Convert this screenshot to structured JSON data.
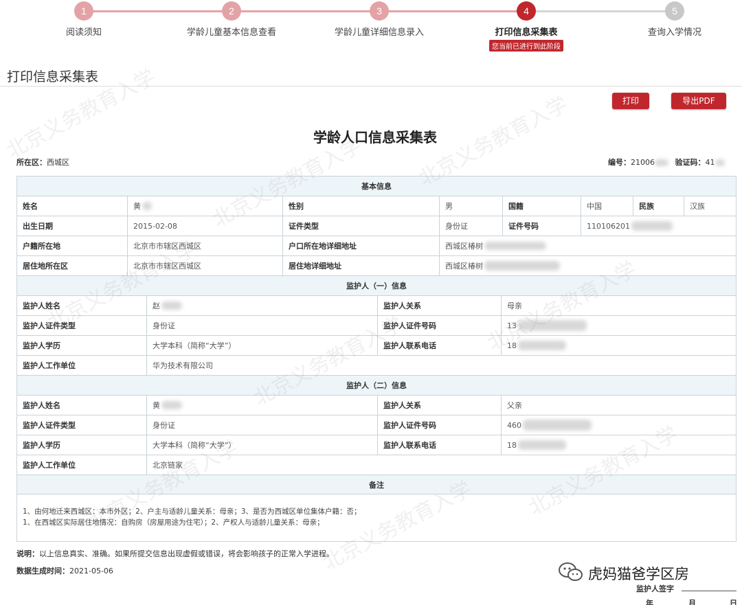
{
  "steps": [
    {
      "num": "1",
      "label": "阅读须知"
    },
    {
      "num": "2",
      "label": "学龄儿童基本信息查看"
    },
    {
      "num": "3",
      "label": "学龄儿童详细信息录入"
    },
    {
      "num": "4",
      "label": "打印信息采集表",
      "badge": "您当前已进行到此阶段"
    },
    {
      "num": "5",
      "label": "查询入学情况"
    }
  ],
  "colors": {
    "accent": "#c0272d",
    "done": "#e3a3a6",
    "pending": "#c8c8c8",
    "section_bg": "#eef5f8"
  },
  "page_title": "打印信息采集表",
  "toolbar": {
    "print_label": "打印",
    "export_label": "导出PDF"
  },
  "form": {
    "title": "学龄人口信息采集表",
    "district_label": "所在区：",
    "district_value": "西城区",
    "number_label": "编号：",
    "number_value": "21006",
    "code_label": "验证码：",
    "code_value": "41",
    "basic": {
      "header": "基本信息",
      "name_label": "姓名",
      "name_value": "黄",
      "gender_label": "性别",
      "gender_value": "男",
      "nationality_label": "国籍",
      "nationality_value": "中国",
      "ethnicity_label": "民族",
      "ethnicity_value": "汉族",
      "birth_label": "出生日期",
      "birth_value": "2015-02-08",
      "id_type_label": "证件类型",
      "id_type_value": "身份证",
      "id_no_label": "证件号码",
      "id_no_value": "110106201",
      "hukou_label": "户籍所在地",
      "hukou_value": "北京市市辖区西城区",
      "hukou_addr_label": "户口所在地详细地址",
      "hukou_addr_value": "西城区椿树",
      "residence_label": "居住地所在区",
      "residence_value": "北京市市辖区西城区",
      "residence_addr_label": "居住地详细地址",
      "residence_addr_value": "西城区椿树"
    },
    "guardian1": {
      "header": "监护人（一）信息",
      "name_label": "监护人姓名",
      "name_value": "赵",
      "relation_label": "监护人关系",
      "relation_value": "母亲",
      "id_type_label": "监护人证件类型",
      "id_type_value": "身份证",
      "id_no_label": "监护人证件号码",
      "id_no_value": "13",
      "edu_label": "监护人学历",
      "edu_value": "大学本科（简称“大学”）",
      "phone_label": "监护人联系电话",
      "phone_value": "18",
      "work_label": "监护人工作单位",
      "work_value": "华为技术有限公司"
    },
    "guardian2": {
      "header": "监护人（二）信息",
      "name_label": "监护人姓名",
      "name_value": "黄",
      "relation_label": "监护人关系",
      "relation_value": "父亲",
      "id_type_label": "监护人证件类型",
      "id_type_value": "身份证",
      "id_no_label": "监护人证件号码",
      "id_no_value": "460",
      "edu_label": "监护人学历",
      "edu_value": "大学本科（简称“大学”）",
      "phone_label": "监护人联系电话",
      "phone_value": "18",
      "work_label": "监护人工作单位",
      "work_value": "北京链家"
    },
    "remarks": {
      "header": "备注",
      "line1": "1、由何地迁来西城区：本市外区；2、户主与适龄儿童关系：母亲；3、是否为西城区单位集体户籍：否；",
      "line2": "1、在西城区实际居住地情况：自购房（房屋用途为住宅）；2、产权人与适龄儿童关系：母亲；"
    },
    "note_label": "说明：",
    "note_text": "以上信息真实、准确。如果所提交信息出现虚假或错误，将会影响孩子的正常入学进程。",
    "gen_time_label": "数据生成时间：",
    "gen_time_value": "2021-05-06",
    "signature_label": "监护人签字",
    "date_year": "年",
    "date_month": "月",
    "date_day": "日"
  },
  "watermark_text": "北京义务教育入学",
  "brand": {
    "icon": "wechat-icon",
    "text": "虎妈猫爸学区房"
  }
}
